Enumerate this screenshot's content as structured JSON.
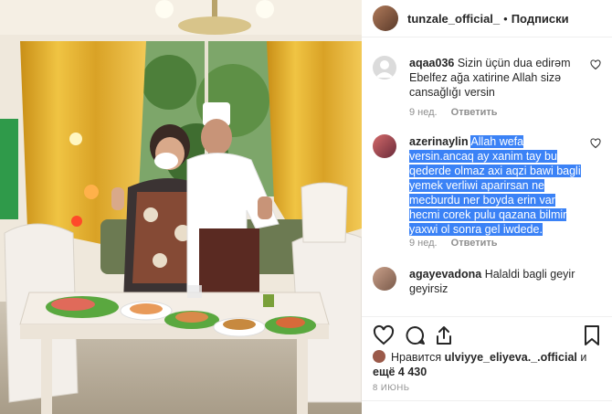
{
  "header": {
    "username": "tunzale_official_",
    "separator": "•",
    "follow_label": "Подписки"
  },
  "comments": [
    {
      "username": "aqaa036",
      "text": "Sizin üçün dua edirəm Ebelfez ağa xatirine Allah sizə cansağlığı versin",
      "time": "9 нед.",
      "reply_label": "Ответить"
    },
    {
      "username": "azerinaylin",
      "text": "Allah wefa versin.ancaq ay xanim tay bu qederde olmaz axi aqzi bawi bagli yemek verliwi aparirsan ne mecburdu ner boyda erin var hecmi corek pulu qazana bilmir yaxwi ol sonra gel iwdede.",
      "time": "9 нед.",
      "reply_label": "Ответить"
    },
    {
      "username": "agayevadona",
      "text": "Halaldi bagli geyir geyirsiz"
    }
  ],
  "likes": {
    "prefix": "Нравится",
    "liker": "ulviyye_eliyeva._.official",
    "suffix": "и",
    "more": "ещё 4 430"
  },
  "date": "8 ИЮНЬ",
  "icons": [
    "like-icon",
    "comment-icon",
    "share-icon",
    "bookmark-icon",
    "heart-small-icon"
  ],
  "colors": {
    "highlight": "#3b82f6",
    "meta_text": "#8e8e8e",
    "text": "#262626"
  }
}
